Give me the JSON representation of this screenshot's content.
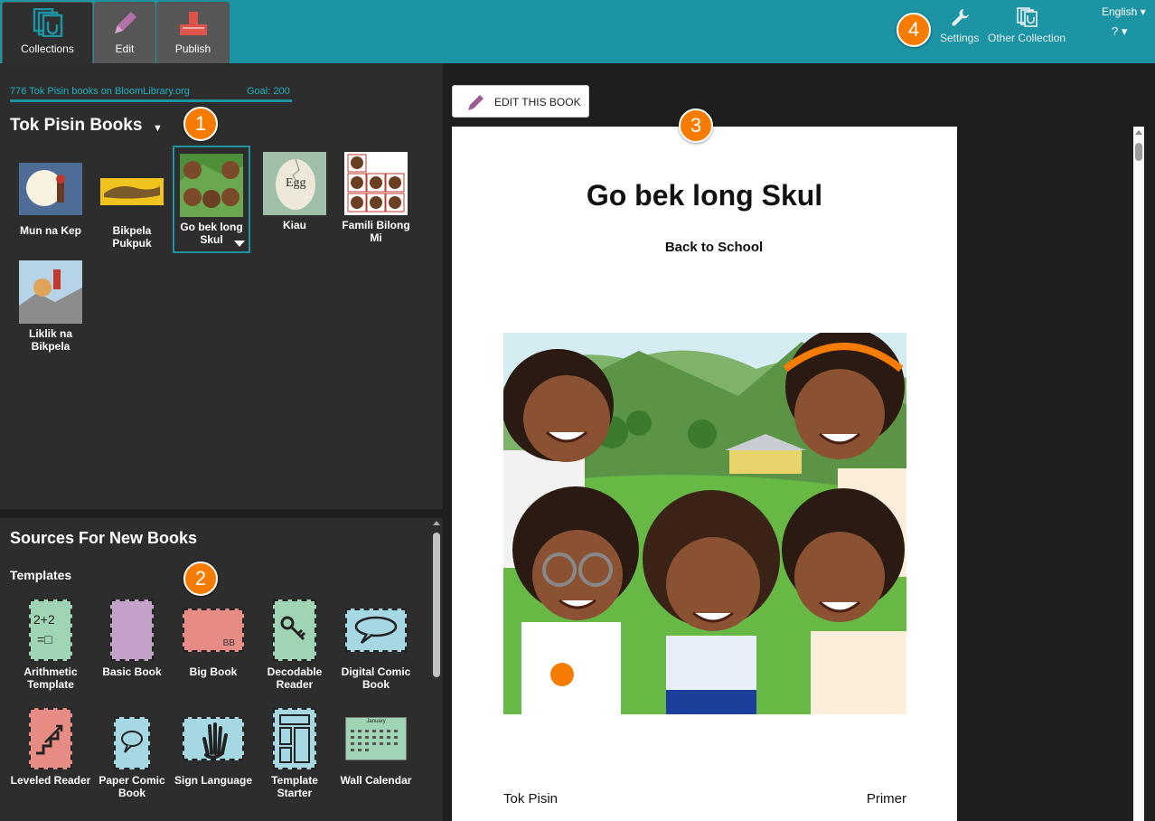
{
  "topbar": {
    "tabs": [
      {
        "label": "Collections",
        "icon": "collections-icon"
      },
      {
        "label": "Edit",
        "icon": "pencil-icon"
      },
      {
        "label": "Publish",
        "icon": "publish-icon"
      }
    ],
    "settings_label": "Settings",
    "other_collection_label": "Other Collection",
    "language": "English ▾",
    "help": "? ▾"
  },
  "collection": {
    "stats_link": "776 Tok Pisin books on BloomLibrary.org",
    "goal": "Goal: 200",
    "title": "Tok Pisin Books",
    "dropdown": "▼",
    "books": [
      {
        "title": "Mun na Kep"
      },
      {
        "title": "Bikpela Pukpuk"
      },
      {
        "title": "Go bek long Skul",
        "selected": true
      },
      {
        "title": "Kiau"
      },
      {
        "title": "Famili Bilong Mi"
      },
      {
        "title": "Liklik na Bikpela"
      }
    ]
  },
  "sources": {
    "title": "Sources For New Books",
    "templates_heading": "Templates",
    "templates": [
      {
        "title": "Arithmetic Template",
        "icon": "arithmetic-icon"
      },
      {
        "title": "Basic Book",
        "icon": "blank-page-icon"
      },
      {
        "title": "Big Book",
        "icon": "big-book-icon"
      },
      {
        "title": "Decodable Reader",
        "icon": "keys-icon"
      },
      {
        "title": "Digital Comic Book",
        "icon": "speech-bubble-icon"
      },
      {
        "title": "Leveled Reader",
        "icon": "stairs-icon"
      },
      {
        "title": "Paper Comic Book",
        "icon": "speech-bubble-icon"
      },
      {
        "title": "Sign Language",
        "icon": "hand-icon"
      },
      {
        "title": "Template Starter",
        "icon": "layout-icon"
      },
      {
        "title": "Wall Calendar",
        "icon": "calendar-icon"
      }
    ],
    "arith_text_top": "2+2",
    "arith_text_bottom": "=□",
    "bigbook_text": "BB",
    "calendar_month": "January"
  },
  "preview": {
    "edit_button": "EDIT THIS BOOK",
    "book_title": "Go bek long Skul",
    "book_subtitle": "Back to School",
    "language": "Tok Pisin",
    "level": "Primer",
    "kiau_text": "Egg"
  },
  "callouts": [
    "1",
    "2",
    "3",
    "4"
  ],
  "colors": {
    "accent": "#1d94a4",
    "callout": "#f57c00",
    "panel": "#2d2d2d"
  }
}
